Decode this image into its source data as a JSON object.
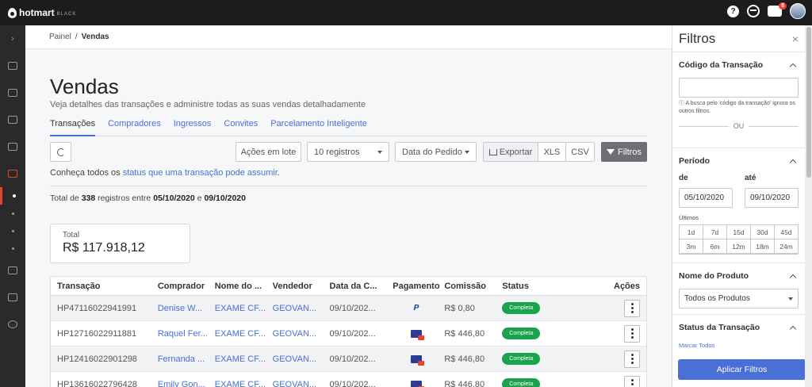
{
  "topbar": {
    "brand": "hotmart",
    "tier": "BLACK",
    "help": "?",
    "notif_count": "8"
  },
  "sidebar": {
    "expand": "›"
  },
  "breadcrumb": {
    "parent": "Painel",
    "sep": "/",
    "current": "Vendas"
  },
  "page": {
    "title": "Vendas",
    "subtitle": "Veja detalhes das transações e administre todas as suas vendas detalhadamente"
  },
  "tabs": [
    "Transações",
    "Compradores",
    "Ingressos",
    "Convites",
    "Parcelamento Inteligente"
  ],
  "toolbar": {
    "lote": "Ações em lote",
    "registros": "10 registros",
    "date": "Data do Pedido",
    "export": "Exportar",
    "xls": "XLS",
    "csv": "CSV",
    "filtros": "Filtros"
  },
  "status_line": {
    "prefix": "Conheça todos os ",
    "link": "status que uma transação pode assumir",
    "suffix": "."
  },
  "totals": {
    "pre": "Total de ",
    "count": "338",
    "mid": " registros entre ",
    "from": "05/10/2020",
    "and": " e ",
    "to": "09/10/2020"
  },
  "total_card": {
    "label": "Total",
    "value": "R$ 117.918,12"
  },
  "table": {
    "headers": [
      "Transação",
      "Comprador",
      "Nome do ...",
      "Vendedor",
      "Data da C...",
      "Pagamento",
      "Comissão",
      "Status",
      "Ações"
    ],
    "rows": [
      {
        "id": "HP47116022941991",
        "buyer": "Denise W...",
        "product": "EXAME CF...",
        "seller": "GEOVAN...",
        "date": "09/10/202...",
        "payment": "P",
        "commission": "R$ 0,80",
        "status": "Completa"
      },
      {
        "id": "HP12716022911881",
        "buyer": "Raquel Fer...",
        "product": "EXAME CF...",
        "seller": "GEOVAN...",
        "date": "09/10/202...",
        "payment": "card",
        "commission": "R$ 446,80",
        "status": "Completa"
      },
      {
        "id": "HP12416022901298",
        "buyer": "Fernanda ...",
        "product": "EXAME CF...",
        "seller": "GEOVAN...",
        "date": "09/10/202...",
        "payment": "card",
        "commission": "R$ 446,80",
        "status": "Completa"
      },
      {
        "id": "HP13616022796428",
        "buyer": "Emily Gon...",
        "product": "EXAME CF...",
        "seller": "GEOVAN...",
        "date": "09/10/202...",
        "payment": "card",
        "commission": "R$ 446,80",
        "status": "Completa"
      }
    ]
  },
  "filters": {
    "title": "Filtros",
    "close": "×",
    "codigo": {
      "label": "Código da Transação",
      "value": "",
      "hint": "ⓘ A busca pelo 'código da transação' ignora os outros filtros.",
      "ou": "OU"
    },
    "periodo": {
      "label": "Período",
      "de": "de",
      "ate": "até",
      "from": "05/10/2020",
      "to": "09/10/2020",
      "ultimos": "Últimos",
      "ranges": [
        "1d",
        "7d",
        "15d",
        "30d",
        "45d",
        "3m",
        "6m",
        "12m",
        "18m",
        "24m"
      ]
    },
    "produto": {
      "label": "Nome do Produto",
      "value": "Todos os Produtos"
    },
    "status": {
      "label": "Status da Transação",
      "marcar": "Marcar Todos"
    },
    "apply": "Aplicar Filtros"
  }
}
